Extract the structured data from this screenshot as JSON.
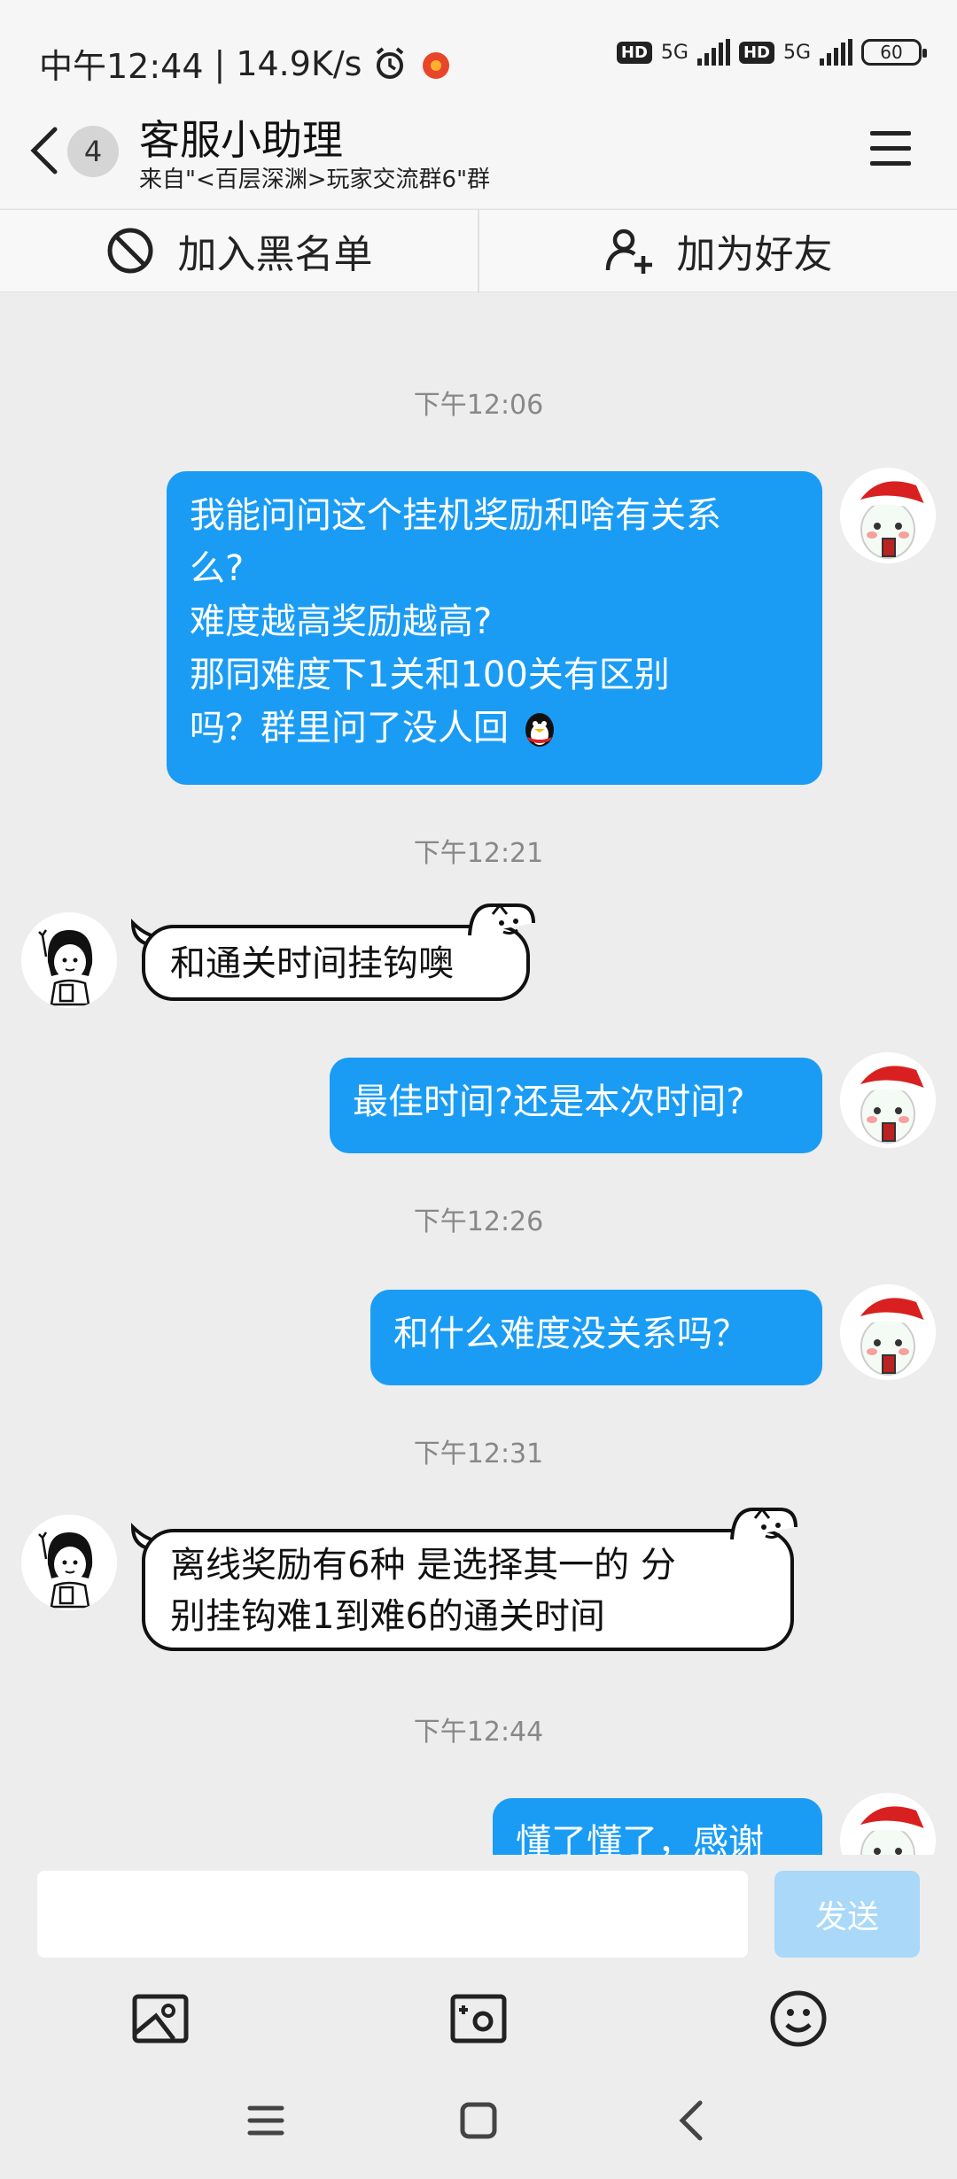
{
  "status_bar": {
    "time": "中午12:44",
    "speed": "14.9K/s",
    "net1": "5G",
    "net2": "5G",
    "hd": "HD",
    "battery": "60"
  },
  "header": {
    "unread_count": "4",
    "title": "客服小助理",
    "subtitle": "来自\"<百层深渊>玩家交流群6\"群"
  },
  "actions": {
    "block_label": "加入黑名单",
    "add_friend_label": "加为好友"
  },
  "messages": {
    "t1": "下午12:06",
    "m1_lines": [
      "我能问问这个挂机奖励和啥有关系",
      "么?",
      "难度越高奖励越高?",
      "那同难度下1关和100关有区别",
      "吗？群里问了没人回"
    ],
    "t2": "下午12:21",
    "m2": "和通关时间挂钩噢",
    "m3": "最佳时间?还是本次时间?",
    "t3": "下午12:26",
    "m4": "和什么难度没关系吗？",
    "t4": "下午12:31",
    "m5_lines": [
      "离线奖励有6种 是选择其一的 分",
      "别挂钩难1到难6的通关时间"
    ],
    "t5": "下午12:44",
    "m6": "懂了懂了，感谢"
  },
  "input": {
    "placeholder": "",
    "send_label": "发送"
  },
  "colors": {
    "outgoing_bubble": "#1a9cf4",
    "send_disabled": "#a9d8f8",
    "background": "#ededed"
  }
}
